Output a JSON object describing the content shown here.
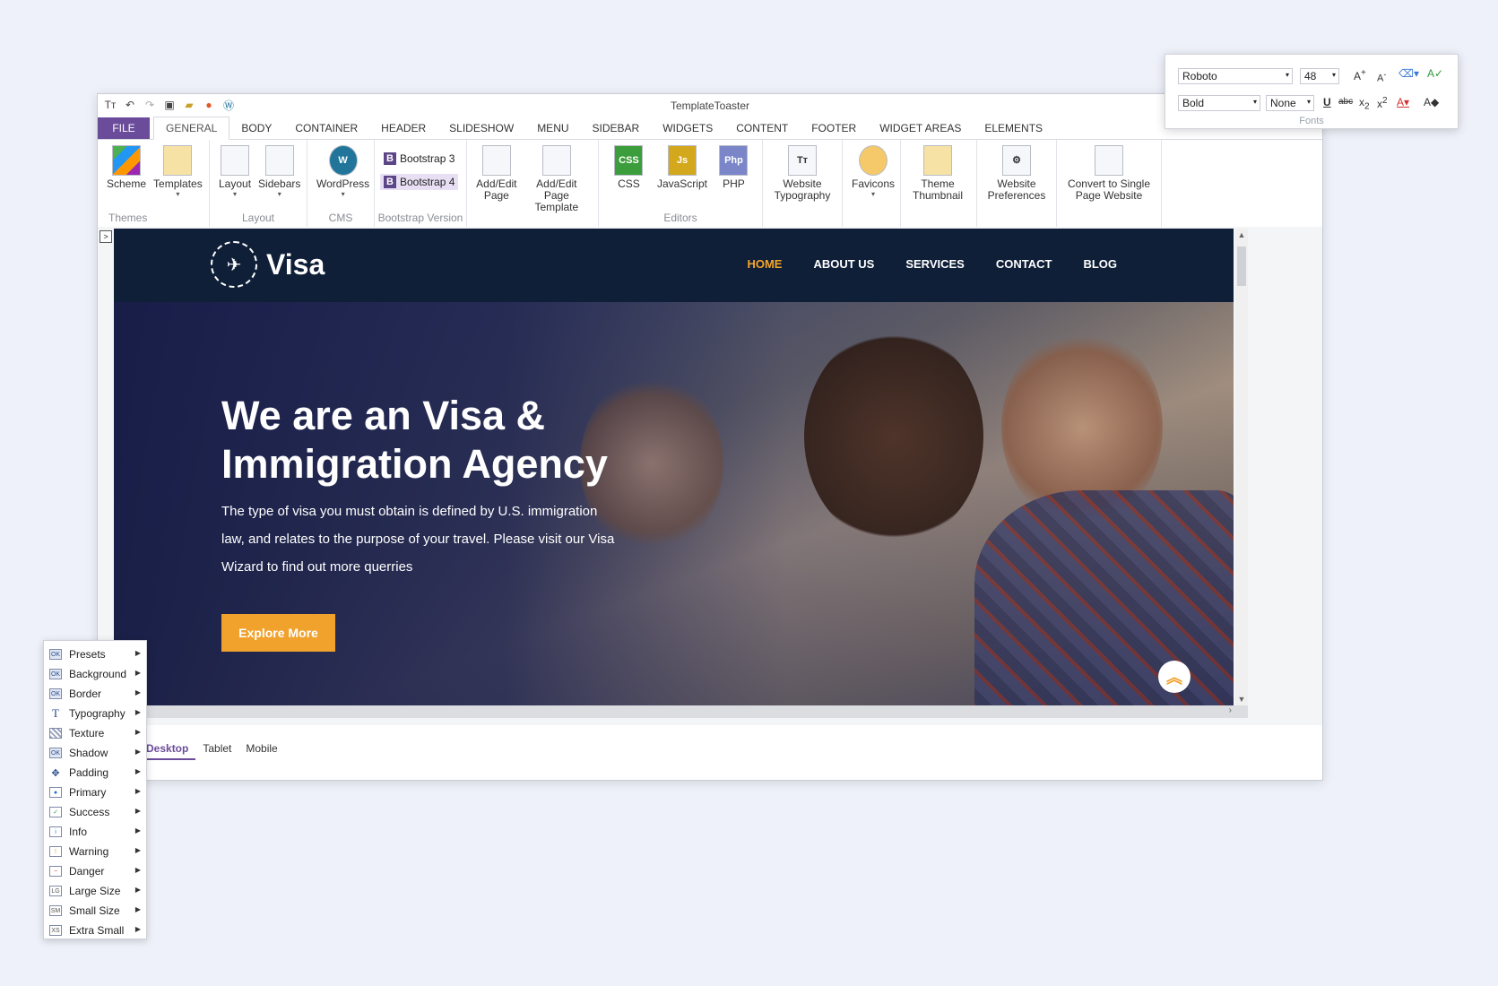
{
  "window": {
    "title": "TemplateToaster"
  },
  "tabs": {
    "file": "FILE",
    "items": [
      "GENERAL",
      "BODY",
      "CONTAINER",
      "HEADER",
      "SLIDESHOW",
      "MENU",
      "SIDEBAR",
      "WIDGETS",
      "CONTENT",
      "FOOTER",
      "WIDGET AREAS",
      "ELEMENTS"
    ]
  },
  "ribbon": {
    "scheme": "Scheme",
    "templates": "Templates",
    "themes_group": "Themes",
    "layout": "Layout",
    "sidebars": "Sidebars",
    "layout_group": "Layout",
    "wordpress": "WordPress",
    "cms_group": "CMS",
    "bootstrap3": "Bootstrap 3",
    "bootstrap4": "Bootstrap 4",
    "bootstrap_group": "Bootstrap Version",
    "add_edit_page": "Add/Edit Page",
    "add_edit_template": "Add/Edit Page Template",
    "css": "CSS",
    "javascript": "JavaScript",
    "php": "PHP",
    "editors_group": "Editors",
    "website_typography": "Website Typography",
    "favicons": "Favicons",
    "theme_thumbnail": "Theme Thumbnail",
    "website_preferences": "Website Preferences",
    "convert_single": "Convert to Single Page Website"
  },
  "site": {
    "logo": "Visa",
    "nav": [
      "HOME",
      "ABOUT US",
      "SERVICES",
      "CONTACT",
      "BLOG"
    ],
    "hero_title": "We are an Visa & Immigration Agency",
    "hero_desc": "The type of visa you must obtain is defined by U.S. immigration law, and relates to the purpose of your travel. Please visit our Visa Wizard to find out more querries",
    "hero_button": "Explore More"
  },
  "devices": [
    "Desktop",
    "Tablet",
    "Mobile"
  ],
  "fonts_panel": {
    "font_family": "Roboto",
    "font_size": "48",
    "font_weight": "Bold",
    "decoration": "None",
    "label": "Fonts"
  },
  "context_menu": [
    "Presets",
    "Background",
    "Border",
    "Typography",
    "Texture",
    "Shadow",
    "Padding",
    "Primary",
    "Success",
    "Info",
    "Warning",
    "Danger",
    "Large Size",
    "Small Size",
    "Extra Small"
  ],
  "colors": {
    "accent": "#6b4c9a",
    "nav_bg": "#0f1f38",
    "brand_orange": "#f0a22d"
  }
}
